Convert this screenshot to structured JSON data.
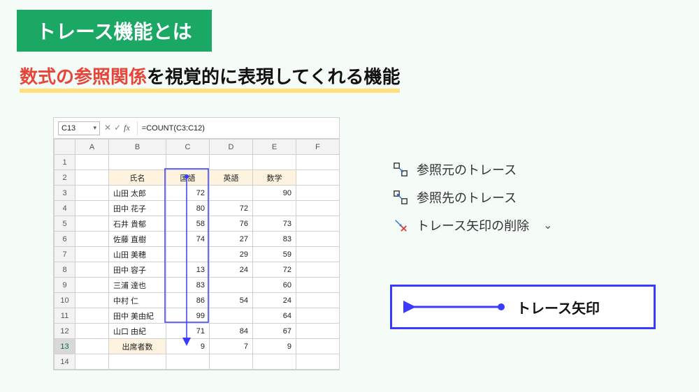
{
  "title": "トレース機能とは",
  "subtitle_accent": "数式の参照関係",
  "subtitle_rest": "を視覚的に表現してくれる機能",
  "excel": {
    "namebox": "C13",
    "formula": "=COUNT(C3:C12)",
    "col_headers": [
      "A",
      "B",
      "C",
      "D",
      "E",
      "F"
    ],
    "row_headers": [
      "1",
      "2",
      "3",
      "4",
      "5",
      "6",
      "7",
      "8",
      "9",
      "10",
      "11",
      "12",
      "13",
      "14"
    ],
    "header_row": {
      "name": "氏名",
      "kokugo": "国語",
      "eigo": "英語",
      "sugaku": "数学"
    },
    "rows": [
      {
        "name": "山田 太郎",
        "c": "72",
        "d": "",
        "e": "90"
      },
      {
        "name": "田中 花子",
        "c": "80",
        "d": "72",
        "e": ""
      },
      {
        "name": "石井 貴郁",
        "c": "58",
        "d": "76",
        "e": "73"
      },
      {
        "name": "佐藤 直樹",
        "c": "74",
        "d": "27",
        "e": "83"
      },
      {
        "name": "山田 美穂",
        "c": "",
        "d": "29",
        "e": "59"
      },
      {
        "name": "田中 容子",
        "c": "13",
        "d": "24",
        "e": "72"
      },
      {
        "name": "三浦 達也",
        "c": "83",
        "d": "",
        "e": "60"
      },
      {
        "name": "中村 仁",
        "c": "86",
        "d": "54",
        "e": "24"
      },
      {
        "name": "田中 美由紀",
        "c": "99",
        "d": "",
        "e": "64"
      },
      {
        "name": "山口 由紀",
        "c": "71",
        "d": "84",
        "e": "67"
      }
    ],
    "footer": {
      "label": "出席者数",
      "c": "9",
      "d": "7",
      "e": "9"
    }
  },
  "menu": {
    "precedents": "参照元のトレース",
    "dependents": "参照先のトレース",
    "remove": "トレース矢印の削除"
  },
  "legend_label": "トレース矢印"
}
